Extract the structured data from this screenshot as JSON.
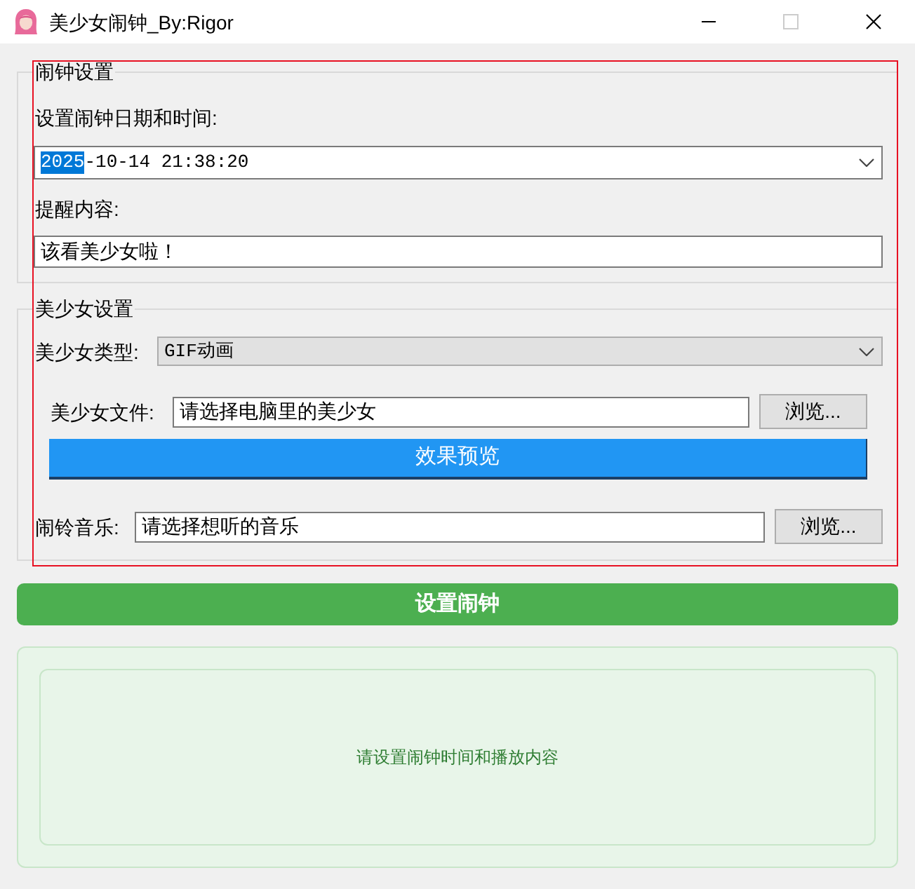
{
  "window": {
    "title": "美少女闹钟_By:Rigor",
    "maximize_disabled": true
  },
  "alarm_group": {
    "title": "闹钟设置",
    "datetime_label": "设置闹钟日期和时间:",
    "datetime_field": {
      "segments": [
        {
          "text": "2025",
          "selected": true
        },
        {
          "text": "-10-14 21:38:20",
          "selected": false
        }
      ]
    },
    "message_label": "提醒内容:",
    "message_field": {
      "value": "该看美少女啦！"
    }
  },
  "girl_group": {
    "title": "美少女设置",
    "type_label": "美少女类型:",
    "type_dropdown": {
      "value": "GIF动画"
    },
    "file_label": "美少女文件:",
    "file_field": {
      "value": "请选择电脑里的美少女"
    },
    "file_browse_button": "浏览...",
    "preview_button": "效果预览",
    "music_label": "闹铃音乐:",
    "music_field": {
      "value": "请选择想听的音乐"
    },
    "music_browse_button": "浏览..."
  },
  "set_alarm_button": "设置闹钟",
  "status_panel": {
    "message": "请设置闹钟时间和播放内容"
  }
}
